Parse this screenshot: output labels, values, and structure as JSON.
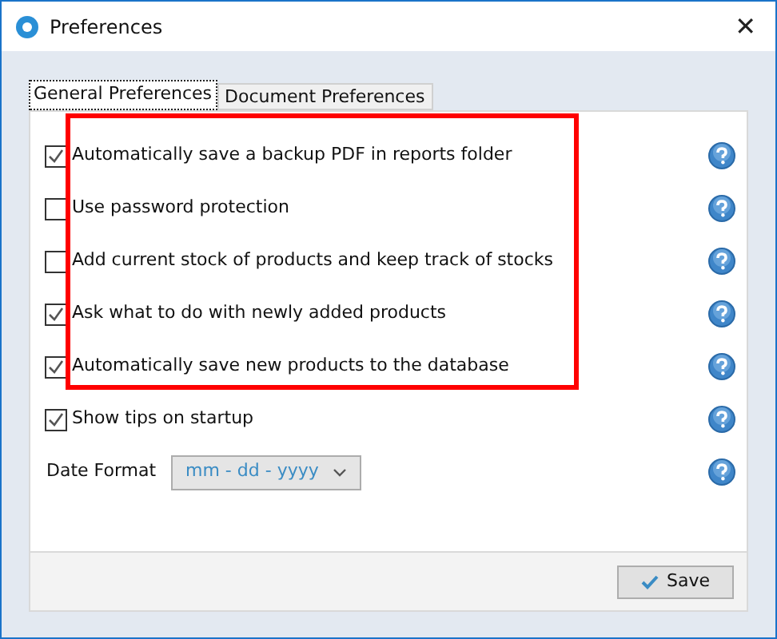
{
  "window": {
    "title": "Preferences",
    "close": "✕"
  },
  "tabs": [
    {
      "label": "General Preferences",
      "selected": true
    },
    {
      "label": "Document Preferences",
      "selected": false
    }
  ],
  "options": [
    {
      "label": "Automatically save a backup PDF in reports folder",
      "checked": true
    },
    {
      "label": "Use password protection",
      "checked": false
    },
    {
      "label": "Add current stock of products and keep track of stocks",
      "checked": false
    },
    {
      "label": "Ask what to do with newly added products",
      "checked": true
    },
    {
      "label": "Automatically save new products to the database",
      "checked": true
    },
    {
      "label": "Show tips on startup",
      "checked": true
    }
  ],
  "date_format": {
    "label": "Date Format",
    "value": "mm - dd - yyyy"
  },
  "buttons": [
    {
      "label": "Save"
    }
  ]
}
